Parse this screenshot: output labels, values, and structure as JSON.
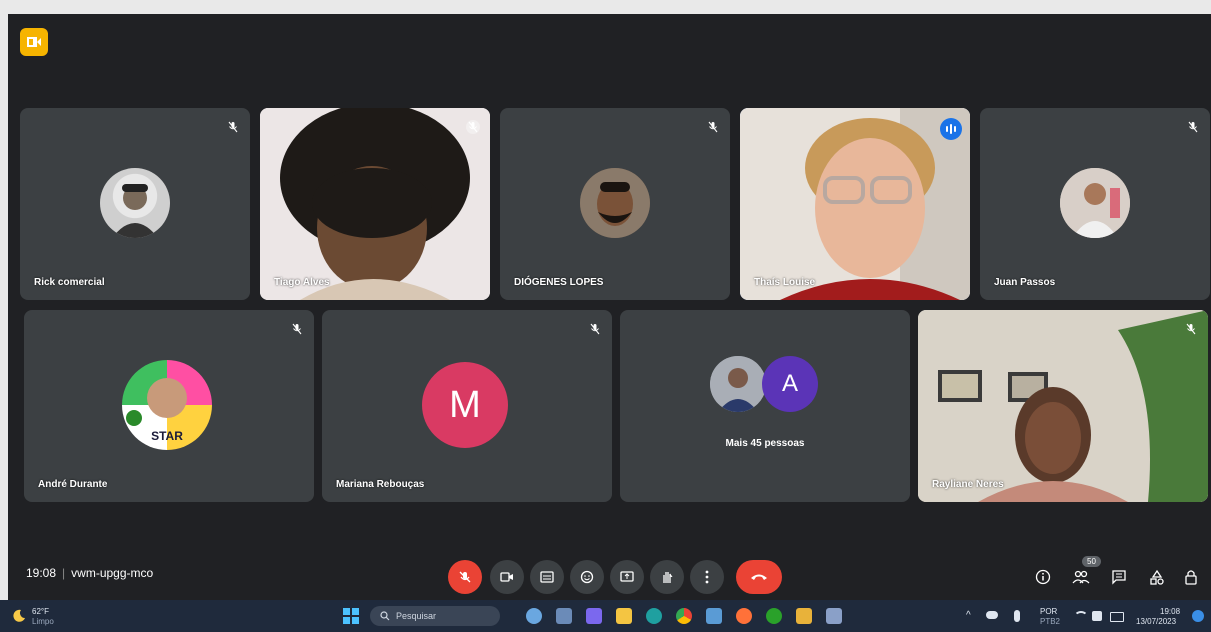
{
  "app": {
    "logo": "google-meet-logo"
  },
  "participants_row1": [
    {
      "name": "Rick comercial",
      "muted": true,
      "kind": "avatar-photo"
    },
    {
      "name": "Tiago Alves",
      "muted": true,
      "kind": "video"
    },
    {
      "name": "DIÓGENES LOPES",
      "muted": true,
      "kind": "avatar-photo"
    },
    {
      "name": "Thaís Louise",
      "speaking": true,
      "kind": "video"
    },
    {
      "name": "Juan Passos",
      "muted": true,
      "kind": "avatar-photo"
    }
  ],
  "participants_row2": [
    {
      "name": "André Durante",
      "muted": true,
      "kind": "avatar-photo",
      "avatar_text": "STAR"
    },
    {
      "name": "Mariana Rebouças",
      "muted": true,
      "kind": "letter",
      "letter": "M",
      "color": "#d93a63"
    },
    {
      "name": "Mais 45 pessoas",
      "kind": "group",
      "letter": "A",
      "color": "#5b34b7"
    },
    {
      "name": "Rayliane Neres",
      "muted": true,
      "kind": "video"
    }
  ],
  "meeting": {
    "time": "19:08",
    "code": "vwm-upgg-mco"
  },
  "controls": [
    "mic-off-icon",
    "camera-icon",
    "captions-icon",
    "emoji-icon",
    "present-icon",
    "raise-hand-icon",
    "more-options-icon",
    "end-call-icon"
  ],
  "right_controls": {
    "people_count": "50"
  },
  "colors": {
    "bg": "#202124",
    "tile": "#3c4043",
    "red": "#ea4335",
    "accent": "#8ab4f8"
  },
  "taskbar": {
    "weather_temp": "62°F",
    "weather_text": "Limpo",
    "search_placeholder": "Pesquisar",
    "lang": "POR",
    "lang_sub": "PTB2",
    "clock_time": "19:08",
    "clock_date": "13/07/2023"
  }
}
